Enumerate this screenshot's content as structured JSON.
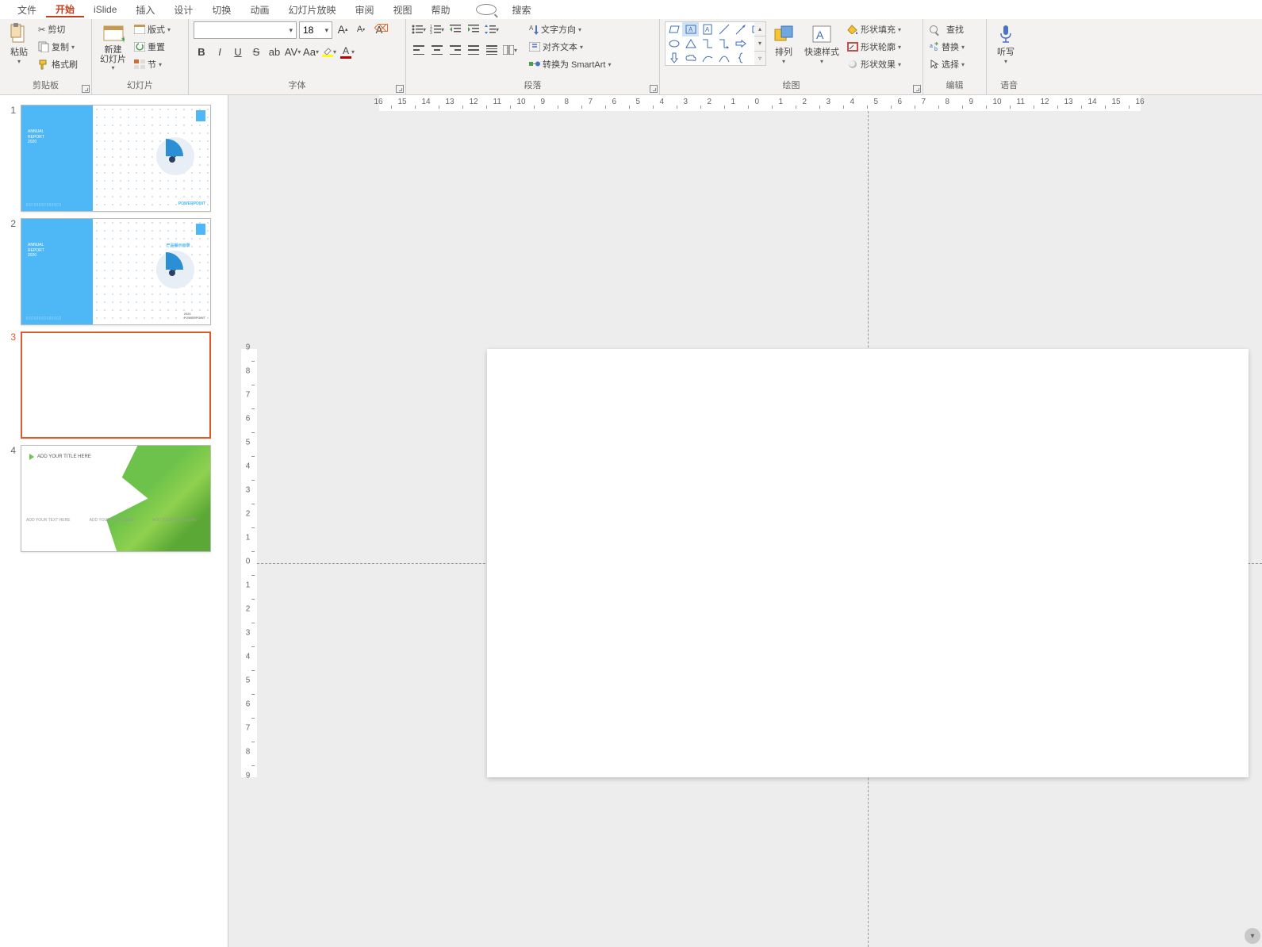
{
  "menu": {
    "file": "文件",
    "home": "开始",
    "islide": "iSlide",
    "insert": "插入",
    "design": "设计",
    "transition": "切换",
    "animation": "动画",
    "slideshow": "幻灯片放映",
    "review": "审阅",
    "view": "视图",
    "help": "帮助",
    "search": "搜索"
  },
  "ribbon": {
    "clipboard": {
      "paste": "粘贴",
      "cut": "剪切",
      "copy": "复制",
      "format_painter": "格式刷",
      "group": "剪贴板"
    },
    "slides": {
      "new_slide": "新建\n幻灯片",
      "layout": "版式",
      "reset": "重置",
      "section": "节",
      "group": "幻灯片"
    },
    "font": {
      "name": "",
      "size": "18",
      "grow": "A",
      "shrink": "A",
      "clear": "A",
      "bold": "B",
      "italic": "I",
      "underline": "U",
      "strike": "S",
      "shadow": "ab",
      "spacing": "AV",
      "case": "Aa",
      "group": "字体"
    },
    "paragraph": {
      "text_dir": "文字方向",
      "align_text": "对齐文本",
      "smartart": "转换为 SmartArt",
      "group": "段落"
    },
    "drawing": {
      "arrange": "排列",
      "quick_style": "快速样式",
      "shape_fill": "形状填充",
      "shape_outline": "形状轮廓",
      "shape_effect": "形状效果",
      "group": "绘图"
    },
    "editing": {
      "find": "查找",
      "replace": "替换",
      "select": "选择",
      "group": "编辑"
    },
    "voice": {
      "dictate": "听写",
      "group": "语音"
    }
  },
  "slides_panel": {
    "s1": "1",
    "s2": "2",
    "s3": "3",
    "s4": "4",
    "t4_title": "ADD YOUR TITLE HERE",
    "t4_item": "ADD YOUR TEXT HERE",
    "t12_brand": "POWERPOINT",
    "t12_label": "ANNUAL\nREPORT\n2020"
  },
  "ruler": {
    "h": [
      "16",
      "15",
      "14",
      "13",
      "12",
      "11",
      "10",
      "9",
      "8",
      "7",
      "6",
      "5",
      "4",
      "3",
      "2",
      "1",
      "0",
      "1",
      "2",
      "3",
      "4",
      "5",
      "6",
      "7",
      "8",
      "9",
      "10",
      "11",
      "12",
      "13",
      "14",
      "15",
      "16"
    ],
    "v": [
      "9",
      "8",
      "7",
      "6",
      "5",
      "4",
      "3",
      "2",
      "1",
      "0",
      "1",
      "2",
      "3",
      "4",
      "5",
      "6",
      "7",
      "8",
      "9"
    ]
  }
}
